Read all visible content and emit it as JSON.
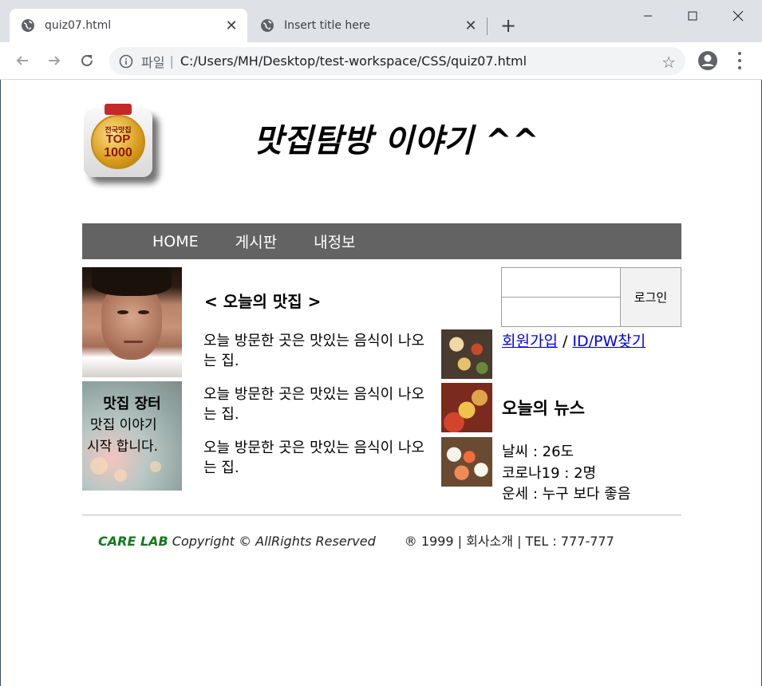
{
  "browser": {
    "tabs": [
      {
        "title": "quiz07.html",
        "active": true
      },
      {
        "title": "Insert title here",
        "active": false
      }
    ],
    "address": {
      "scheme_label": "파일",
      "separator": "|",
      "url": "C:/Users/MH/Desktop/test-workspace/CSS/quiz07.html"
    },
    "new_tab": "+",
    "close_glyph": "✕"
  },
  "site": {
    "title": "맛집탐방 이야기 ^^",
    "logo": {
      "line1": "전국맛집",
      "line2": "TOP",
      "line3": "1000"
    }
  },
  "nav": {
    "items": [
      "HOME",
      "게시판",
      "내정보"
    ]
  },
  "sidebar": {
    "market_title": "맛집 장터",
    "market_line1": "맛집 이야기",
    "market_line2": "시작 합니다."
  },
  "main": {
    "heading": "< 오늘의 맛집 >",
    "posts": [
      {
        "text": "오늘 방문한 곳은 맛있는 음식이 나오는 집."
      },
      {
        "text": "오늘 방문한 곳은 맛있는 음식이 나오는 집."
      },
      {
        "text": "오늘 방문한 곳은 맛있는 음식이 나오는 집."
      }
    ]
  },
  "login": {
    "button_label": "로그인",
    "id_value": "",
    "pw_value": "",
    "signup_link": "회원가입",
    "link_separator": " / ",
    "find_link": "ID/PW찾기"
  },
  "news": {
    "title": "오늘의 뉴스",
    "items": [
      "날씨 : 26도",
      "코로나19 : 2명",
      "운세 : 누구 보다 좋음"
    ]
  },
  "footer": {
    "brand": "CARE LAB",
    "copyright": " Copyright © AllRights Reserved",
    "info": "® 1999 | 회사소개 | TEL : 777-777"
  },
  "colors": {
    "nav_bg": "#636363",
    "brand_green": "#117a1d",
    "link_blue": "#0000ee"
  }
}
